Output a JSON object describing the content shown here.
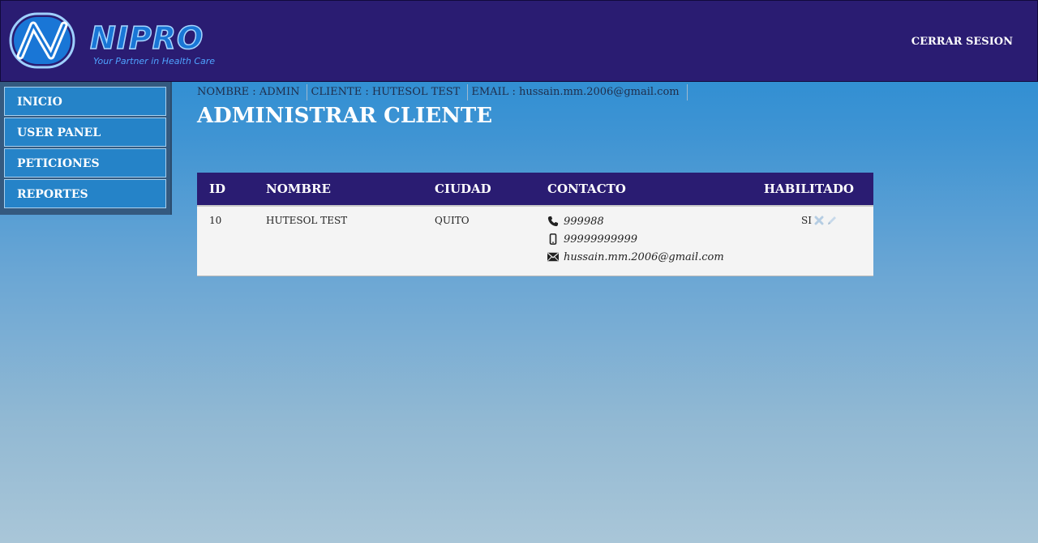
{
  "header": {
    "brand_name": "NIPRO",
    "brand_tagline": "Your Partner in Health Care",
    "logout_label": "CERRAR SESION"
  },
  "sidebar": {
    "items": [
      {
        "label": "INICIO"
      },
      {
        "label": "USER PANEL"
      },
      {
        "label": "PETICIONES"
      },
      {
        "label": "REPORTES"
      }
    ]
  },
  "info": {
    "nombre": "NOMBRE : ADMIN",
    "cliente": "CLIENTE : HUTESOL TEST",
    "email": "EMAIL : hussain.mm.2006@gmail.com"
  },
  "page": {
    "title": "ADMINISTRAR CLIENTE"
  },
  "table": {
    "headers": {
      "id": "ID",
      "nombre": "NOMBRE",
      "ciudad": "CIUDAD",
      "contacto": "CONTACTO",
      "habilitado": "HABILITADO"
    },
    "rows": [
      {
        "id": "10",
        "nombre": "HUTESOL TEST",
        "ciudad": "QUITO",
        "phone": "999988",
        "mobile": "99999999999",
        "email": "hussain.mm.2006@gmail.com",
        "habilitado": "SI"
      }
    ]
  },
  "icons": {
    "phone": "phone-icon",
    "mobile": "mobile-icon",
    "email": "envelope-icon",
    "disable": "close-icon",
    "edit": "pencil-icon"
  },
  "colors": {
    "header_bg": "#2a1c72",
    "sidebar_item_bg": "#2583c8",
    "row_bg": "#f4f4f4"
  }
}
